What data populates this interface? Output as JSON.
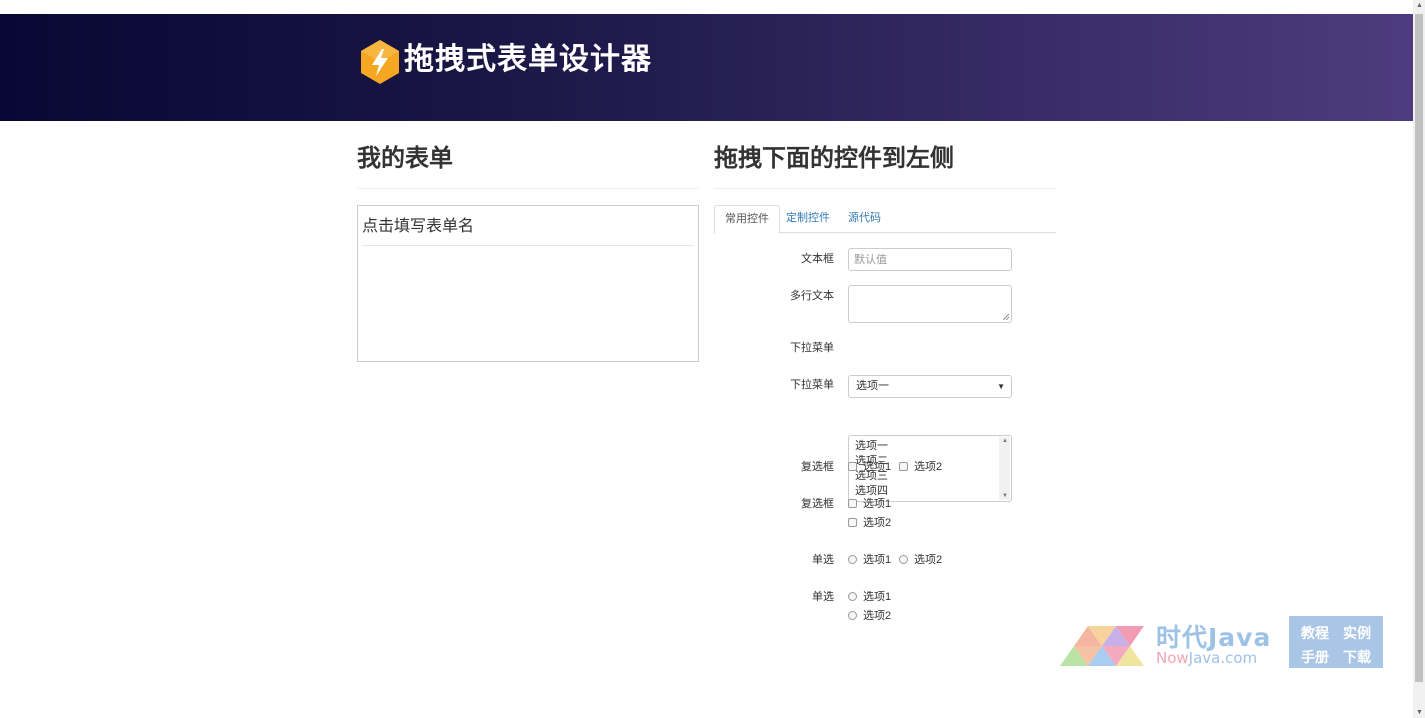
{
  "header": {
    "title": "拖拽式表单设计器"
  },
  "left": {
    "heading": "我的表单",
    "form_name_placeholder": "点击填写表单名"
  },
  "right": {
    "heading": "拖拽下面的控件到左侧",
    "tabs": [
      {
        "label": "常用控件",
        "active": true
      },
      {
        "label": "定制控件",
        "active": false
      },
      {
        "label": "源代码",
        "active": false
      }
    ],
    "fields": {
      "textbox": {
        "label": "文本框",
        "placeholder": "默认值"
      },
      "textarea": {
        "label": "多行文本"
      },
      "dropdown": {
        "label": "下拉菜单",
        "selected": "选项一"
      },
      "listbox": {
        "label": "下拉菜单",
        "options": [
          "选项一",
          "选项二",
          "选项三",
          "选项四"
        ]
      },
      "checkbox_inline": {
        "label": "复选框",
        "options": [
          "选项1",
          "选项2"
        ]
      },
      "checkbox_stacked": {
        "label": "复选框",
        "options": [
          "选项1",
          "选项2"
        ]
      },
      "radio_inline": {
        "label": "单选",
        "options": [
          "选项1",
          "选项2"
        ]
      },
      "radio_stacked": {
        "label": "单选",
        "options": [
          "选项1",
          "选项2"
        ]
      }
    }
  },
  "watermark": {
    "title": "时代Java",
    "sub_a": "Now",
    "sub_b": "Java.com",
    "box": [
      "教程",
      "实例",
      "手册",
      "下载"
    ]
  },
  "colors": {
    "header_start": "#070833",
    "header_end": "#4f3b7f",
    "logo": "#f5a623",
    "link": "#337ab7"
  }
}
